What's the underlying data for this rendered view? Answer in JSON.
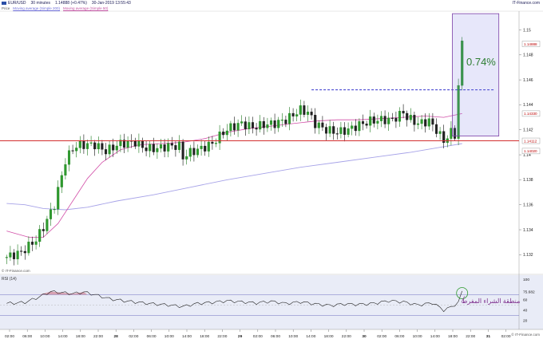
{
  "header": {
    "symbol": "EUR/USD",
    "interval": "30 minutes",
    "last": "1.14888 (+0.47%)",
    "datetime": "30-Jan-2019 13:55:43",
    "brand": "IT-Finance.com",
    "price_label": "Price",
    "ma1_label": "Moving average (Simple 200)",
    "ma2_label": "Moving average (Simple 50)"
  },
  "watermarks": {
    "top": "© IT-Finance.com",
    "bottom": "© IT-Finance.com"
  },
  "annotation": {
    "percent": "0.74%",
    "arabic_label": "منطقة الشراء المفرط"
  },
  "colors": {
    "up": "#1d7a1d",
    "down": "#111111",
    "ma50": "#d24fa8",
    "ma200": "#a7a3e8",
    "support": "#d32f2f",
    "resistance": "#3333cc",
    "box": "#7b3fa8",
    "rsi": "#222222"
  },
  "chart_data": [
    {
      "type": "candlestick",
      "title": "EUR/USD 30 minutes",
      "ylim": [
        1.131,
        1.1515
      ],
      "yticks": [
        "1.15",
        "1.148",
        "1.146",
        "1.144",
        "1.142",
        "1.14",
        "1.138",
        "1.136",
        "1.134",
        "1.132"
      ],
      "yticks_num": [
        1.15,
        1.148,
        1.146,
        1.144,
        1.142,
        1.14,
        1.138,
        1.136,
        1.134,
        1.132
      ],
      "xticks": [
        "02:00",
        "06:00",
        "10:00",
        "14:00",
        "18:00",
        "22:00",
        "28",
        "02:00",
        "06:00",
        "10:00",
        "14:00",
        "18:00",
        "22:00",
        "29",
        "02:00",
        "06:00",
        "10:00",
        "14:00",
        "18:00",
        "22:00",
        "30",
        "02:00",
        "06:00",
        "10:00",
        "14:00",
        "18:00",
        "22:00",
        "31",
        "02:00"
      ],
      "candle_count": 125,
      "close_path": [
        [
          0,
          1.1318
        ],
        [
          4,
          1.1322
        ],
        [
          8,
          1.1332
        ],
        [
          10,
          1.1342
        ],
        [
          13,
          1.136
        ],
        [
          16,
          1.1395
        ],
        [
          18,
          1.1405
        ],
        [
          20,
          1.1408
        ],
        [
          24,
          1.1408
        ],
        [
          27,
          1.1403
        ],
        [
          31,
          1.1409
        ],
        [
          35,
          1.141
        ],
        [
          38,
          1.1405
        ],
        [
          41,
          1.1405
        ],
        [
          44,
          1.1407
        ],
        [
          47,
          1.1407
        ],
        [
          48,
          1.1398
        ],
        [
          50,
          1.1402
        ],
        [
          53,
          1.1405
        ],
        [
          56,
          1.1409
        ],
        [
          59,
          1.1418
        ],
        [
          61,
          1.1422
        ],
        [
          64,
          1.1425
        ],
        [
          67,
          1.1422
        ],
        [
          70,
          1.1424
        ],
        [
          73,
          1.1425
        ],
        [
          76,
          1.1428
        ],
        [
          78,
          1.1432
        ],
        [
          80,
          1.1436
        ],
        [
          82,
          1.1434
        ],
        [
          84,
          1.1425
        ],
        [
          87,
          1.142
        ],
        [
          90,
          1.1418
        ],
        [
          93,
          1.142
        ],
        [
          96,
          1.1424
        ],
        [
          99,
          1.1427
        ],
        [
          102,
          1.1428
        ],
        [
          105,
          1.1428
        ],
        [
          108,
          1.1434
        ],
        [
          109,
          1.143
        ],
        [
          112,
          1.1425
        ],
        [
          115,
          1.1427
        ],
        [
          117,
          1.142
        ],
        [
          119,
          1.1411
        ],
        [
          121,
          1.1418
        ],
        [
          122,
          1.1416
        ],
        [
          123,
          1.1455
        ],
        [
          124,
          1.1489
        ]
      ],
      "sma50": [
        [
          0,
          1.1339
        ],
        [
          6,
          1.1334
        ],
        [
          10,
          1.1334
        ],
        [
          14,
          1.1345
        ],
        [
          18,
          1.1363
        ],
        [
          22,
          1.1381
        ],
        [
          26,
          1.1394
        ],
        [
          31,
          1.1404
        ],
        [
          36,
          1.1408
        ],
        [
          42,
          1.1409
        ],
        [
          48,
          1.141
        ],
        [
          54,
          1.1413
        ],
        [
          60,
          1.1418
        ],
        [
          66,
          1.1421
        ],
        [
          72,
          1.1423
        ],
        [
          78,
          1.1425
        ],
        [
          84,
          1.1427
        ],
        [
          90,
          1.1428
        ],
        [
          96,
          1.1428
        ],
        [
          102,
          1.1429
        ],
        [
          108,
          1.143
        ],
        [
          114,
          1.1431
        ],
        [
          119,
          1.143
        ],
        [
          124,
          1.1433
        ]
      ],
      "sma200": [
        [
          0,
          1.1361
        ],
        [
          5,
          1.136
        ],
        [
          10,
          1.1357
        ],
        [
          16,
          1.1356
        ],
        [
          22,
          1.1358
        ],
        [
          30,
          1.1363
        ],
        [
          40,
          1.1368
        ],
        [
          50,
          1.1374
        ],
        [
          60,
          1.138
        ],
        [
          70,
          1.1385
        ],
        [
          80,
          1.139
        ],
        [
          90,
          1.1394
        ],
        [
          100,
          1.1398
        ],
        [
          110,
          1.1402
        ],
        [
          118,
          1.1406
        ],
        [
          124,
          1.1409
        ]
      ],
      "support": 1.14112,
      "resistance": 1.1452,
      "resistance_start_index": 83,
      "box": {
        "x0": 122,
        "x1": 134,
        "y_low": 1.1415,
        "y_high": 1.1513
      },
      "price_tags": [
        {
          "label": "1.14888",
          "value": 1.14888
        },
        {
          "label": "1.14330",
          "value": 1.1433
        },
        {
          "label": "1.14112",
          "value": 1.14112
        },
        {
          "label": "1.14020",
          "value": 1.1403
        }
      ]
    },
    {
      "type": "line",
      "title": "RSI (14)",
      "ylim": [
        15,
        100
      ],
      "yticks": [
        "100",
        "75.682",
        "60",
        "40",
        "20"
      ],
      "yticks_num": [
        100,
        75.682,
        60,
        40,
        20
      ],
      "bands": [
        70,
        30
      ],
      "rsi": [
        [
          0,
          53
        ],
        [
          5,
          55
        ],
        [
          9,
          66
        ],
        [
          12,
          76
        ],
        [
          15,
          74
        ],
        [
          18,
          72
        ],
        [
          21,
          75
        ],
        [
          24,
          70
        ],
        [
          28,
          62
        ],
        [
          32,
          58
        ],
        [
          36,
          55
        ],
        [
          40,
          52
        ],
        [
          44,
          50
        ],
        [
          48,
          47
        ],
        [
          52,
          53
        ],
        [
          56,
          55
        ],
        [
          60,
          58
        ],
        [
          64,
          56
        ],
        [
          68,
          54
        ],
        [
          72,
          57
        ],
        [
          76,
          53
        ],
        [
          80,
          56
        ],
        [
          84,
          52
        ],
        [
          88,
          49
        ],
        [
          92,
          52
        ],
        [
          96,
          51
        ],
        [
          100,
          53
        ],
        [
          104,
          58
        ],
        [
          108,
          56
        ],
        [
          112,
          50
        ],
        [
          116,
          54
        ],
        [
          119,
          40
        ],
        [
          121,
          46
        ],
        [
          123,
          55
        ],
        [
          124,
          76
        ]
      ]
    }
  ]
}
